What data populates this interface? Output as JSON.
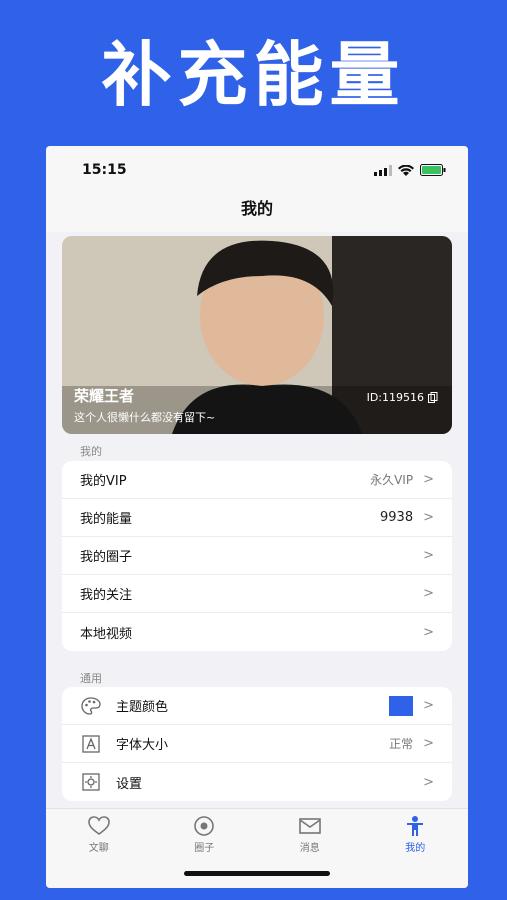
{
  "promo": {
    "title": "补充能量"
  },
  "status": {
    "time": "15:15"
  },
  "nav": {
    "title": "我的"
  },
  "profile": {
    "name": "荣耀王者",
    "description": "这个人很懒什么都没有留下~",
    "id": "ID:119516"
  },
  "sections": {
    "mine_label": "我的",
    "general_label": "通用"
  },
  "mine_items": [
    {
      "label": "我的VIP",
      "value": "永久VIP"
    },
    {
      "label": "我的能量",
      "value": "9938"
    },
    {
      "label": "我的圈子",
      "value": ""
    },
    {
      "label": "我的关注",
      "value": ""
    },
    {
      "label": "本地视频",
      "value": ""
    }
  ],
  "general_items": [
    {
      "label": "主题颜色",
      "icon": "palette-icon",
      "swatch_color": "#2f62e8"
    },
    {
      "label": "字体大小",
      "icon": "font-size-icon",
      "value": "正常"
    },
    {
      "label": "设置",
      "icon": "settings-icon"
    }
  ],
  "tabs": [
    {
      "label": "文聊",
      "icon": "heart-icon"
    },
    {
      "label": "圈子",
      "icon": "eye-icon"
    },
    {
      "label": "消息",
      "icon": "mail-icon"
    },
    {
      "label": "我的",
      "icon": "person-icon",
      "active": true
    }
  ],
  "colors": {
    "accent": "#2f62e8",
    "background": "#f2f2f6"
  }
}
